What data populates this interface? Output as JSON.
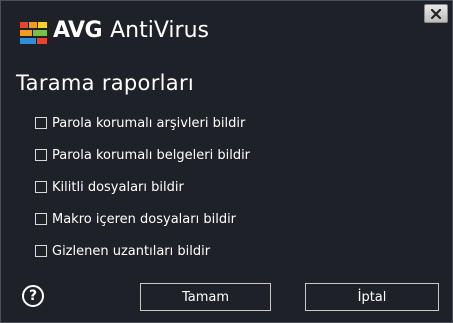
{
  "window": {
    "brand_name": "AVG",
    "product_name": "AntiVirus",
    "close_icon": "close-icon"
  },
  "page": {
    "title": "Tarama raporları"
  },
  "options": [
    {
      "label": "Parola korumalı arşivleri bildir",
      "checked": false
    },
    {
      "label": "Parola korumalı belgeleri bildir",
      "checked": false
    },
    {
      "label": "Kilitli dosyaları bildir",
      "checked": false
    },
    {
      "label": "Makro içeren dosyaları bildir",
      "checked": false
    },
    {
      "label": "Gizlenen uzantıları bildir",
      "checked": false
    }
  ],
  "footer": {
    "help_symbol": "?",
    "ok_label": "Tamam",
    "cancel_label": "İptal"
  },
  "colors": {
    "background": "#1e2228",
    "text": "#ffffff",
    "logo_red": "#e8452c",
    "logo_orange": "#f29b1e",
    "logo_yellow": "#f6d32a",
    "logo_green": "#7ac043",
    "logo_blue": "#2f8fd6"
  }
}
